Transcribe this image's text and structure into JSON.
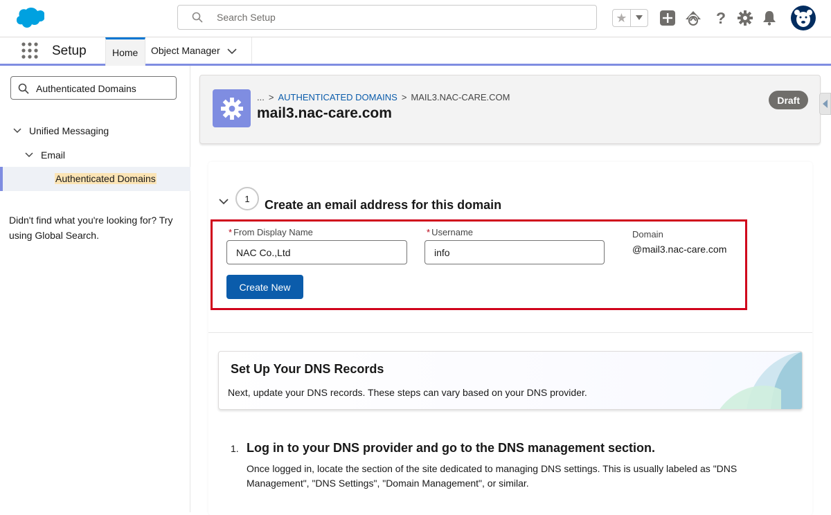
{
  "header": {
    "search_placeholder": "Search Setup",
    "icons": [
      "cloud-logo",
      "search-icon",
      "star-icon",
      "chevron-down-icon",
      "plus-icon",
      "trailhead-icon",
      "help-icon",
      "gear-icon",
      "bell-icon",
      "avatar-icon"
    ]
  },
  "context_bar": {
    "app_name": "Setup",
    "tabs": [
      {
        "label": "Home"
      },
      {
        "label": "Object Manager"
      }
    ]
  },
  "sidebar": {
    "quick_find_value": "Authenticated Domains",
    "tree": [
      {
        "label": "Unified Messaging"
      },
      {
        "label": "Email"
      },
      {
        "label": "Authenticated Domains"
      }
    ],
    "not_found_text": "Didn't find what you're looking for? Try using Global Search."
  },
  "page_header": {
    "breadcrumb": {
      "ellipsis": "...",
      "sep1": ">",
      "link": "AUTHENTICATED DOMAINS",
      "sep2": ">",
      "current": "MAIL3.NAC-CARE.COM"
    },
    "title": "mail3.nac-care.com",
    "badge": "Draft"
  },
  "step1": {
    "number": "1",
    "title": "Create an email address for this domain",
    "from_display_name": {
      "label": "From Display Name",
      "value": "NAC Co.,Ltd"
    },
    "username": {
      "label": "Username",
      "value": "info"
    },
    "required_mark": "*",
    "domain_label": "Domain",
    "domain_value": "@mail3.nac-care.com",
    "create_button": "Create New"
  },
  "dns_section": {
    "title": "Set Up Your DNS Records",
    "description": "Next, update your DNS records. These steps can vary based on your DNS provider."
  },
  "dns_step": {
    "number": "1.",
    "title": "Log in to your DNS provider and go to the DNS management section.",
    "description": "Once logged in, locate the section of the site dedicated to managing DNS settings. This is usually labeled as \"DNS Management\", \"DNS Settings\", \"Domain Management\", or similar."
  },
  "colors": {
    "brand_blue": "#0b5cab",
    "setup_accent": "#7f8de1",
    "highlight_red": "#d0021b",
    "badge_gray": "#706e6b"
  }
}
